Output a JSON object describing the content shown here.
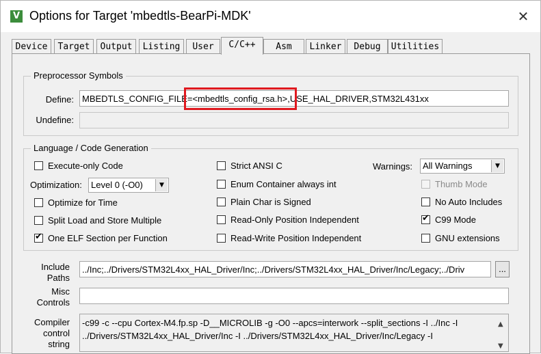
{
  "window": {
    "title": "Options for Target 'mbedtls-BearPi-MDK'",
    "app_icon": "V",
    "close_symbol": "✕"
  },
  "tabs": [
    "Device",
    "Target",
    "Output",
    "Listing",
    "User",
    "C/C++",
    "Asm",
    "Linker",
    "Debug",
    "Utilities"
  ],
  "active_tab": "C/C++",
  "preprocessor": {
    "group_label": "Preprocessor Symbols",
    "define_label": "Define:",
    "define_value": "MBEDTLS_CONFIG_FILE=<mbedtls_config_rsa.h>,USE_HAL_DRIVER,STM32L431xx",
    "undefine_label": "Undefine:",
    "undefine_value": ""
  },
  "highlight_color": "#e0191f",
  "language": {
    "group_label": "Language / Code Generation",
    "execute_only": {
      "label": "Execute-only Code",
      "checked": false
    },
    "optimization_label": "Optimization:",
    "optimization_value": "Level 0 (-O0)",
    "optimize_time": {
      "label": "Optimize for Time",
      "checked": false
    },
    "split_load": {
      "label": "Split Load and Store Multiple",
      "checked": false
    },
    "one_elf": {
      "label": "One ELF Section per Function",
      "checked": true
    },
    "strict_ansi": {
      "label": "Strict ANSI C",
      "checked": false
    },
    "enum_container": {
      "label": "Enum Container always int",
      "checked": false
    },
    "plain_char": {
      "label": "Plain Char is Signed",
      "checked": false
    },
    "ropi": {
      "label": "Read-Only Position Independent",
      "checked": false
    },
    "rwpi": {
      "label": "Read-Write Position Independent",
      "checked": false
    },
    "warnings_label": "Warnings:",
    "warnings_value": "All Warnings",
    "thumb_mode": {
      "label": "Thumb Mode",
      "checked": false,
      "disabled": true
    },
    "no_auto_includes": {
      "label": "No Auto Includes",
      "checked": false
    },
    "c99_mode": {
      "label": "C99 Mode",
      "checked": true
    },
    "gnu_extensions": {
      "label": "GNU extensions",
      "checked": false
    }
  },
  "include_paths": {
    "label_line1": "Include",
    "label_line2": "Paths",
    "value": "../Inc;../Drivers/STM32L4xx_HAL_Driver/Inc;../Drivers/STM32L4xx_HAL_Driver/Inc/Legacy;../Driv",
    "browse_label": "..."
  },
  "misc_controls": {
    "label_line1": "Misc",
    "label_line2": "Controls",
    "value": ""
  },
  "compiler_control": {
    "label_line1": "Compiler",
    "label_line2": "control",
    "label_line3": "string",
    "line1": "-c99 -c --cpu Cortex-M4.fp.sp -D__MICROLIB -g -O0 --apcs=interwork --split_sections -I ../Inc -I",
    "line2": "../Drivers/STM32L4xx_HAL_Driver/Inc -I ../Drivers/STM32L4xx_HAL_Driver/Inc/Legacy -I"
  },
  "icons": {
    "check": "✔",
    "combo_arrow": "▼",
    "scroll_up": "▲",
    "scroll_down": "▼"
  }
}
